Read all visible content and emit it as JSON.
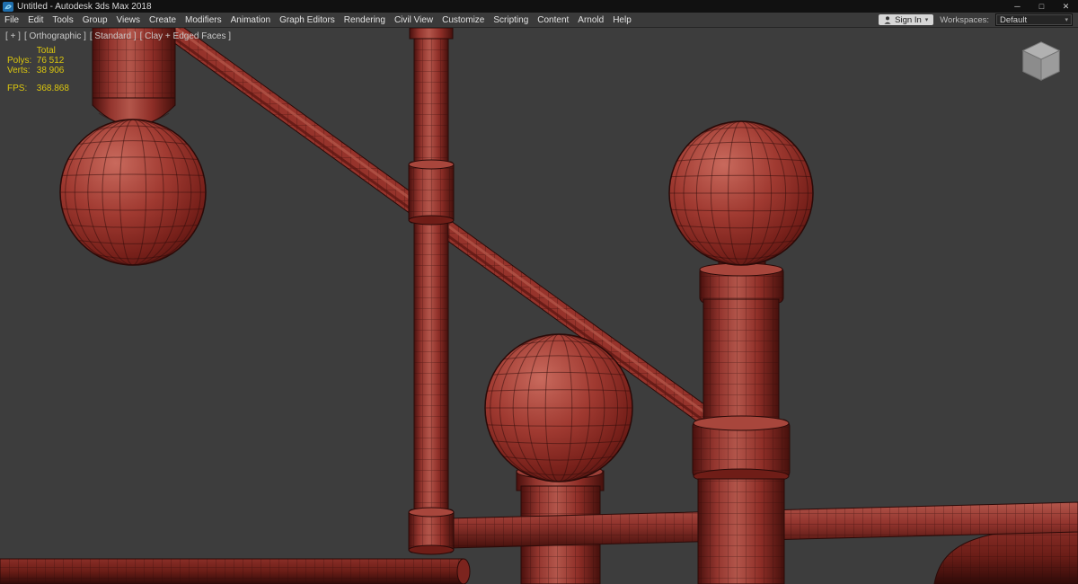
{
  "window": {
    "title": "Untitled - Autodesk 3ds Max 2018"
  },
  "icons": {
    "minimize": "─",
    "maximize": "□",
    "close": "✕",
    "caret_down": "▾",
    "app_icon": "3ds-max-logo",
    "user_icon": "user-silhouette",
    "viewcube": "viewcube-3d"
  },
  "menu_bar": {
    "items": [
      "File",
      "Edit",
      "Tools",
      "Group",
      "Views",
      "Create",
      "Modifiers",
      "Animation",
      "Graph Editors",
      "Rendering",
      "Civil View",
      "Customize",
      "Scripting",
      "Content",
      "Arnold",
      "Help"
    ],
    "sign_in_label": "Sign In",
    "workspaces_label": "Workspaces:",
    "workspaces_value": "Default"
  },
  "viewport": {
    "labels": [
      "[ + ]",
      "[ Orthographic ]",
      "[ Standard ]",
      "[ Clay + Edged Faces ]"
    ],
    "stats": {
      "total_label": "Total",
      "polys_label": "Polys:",
      "polys_value": "76 512",
      "verts_label": "Verts:",
      "verts_value": "38 906",
      "fps_label": "FPS:",
      "fps_value": "368.868"
    },
    "colors": {
      "background": "#3d3d3d",
      "clay_base": "#96332b",
      "clay_highlight": "#b5564b",
      "clay_shadow": "#4a100d",
      "wireframe": "#2e0c09",
      "stats_text": "#dcc70e"
    }
  }
}
